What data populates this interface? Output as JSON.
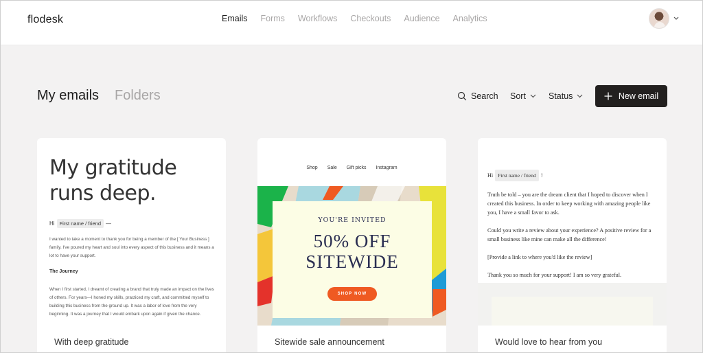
{
  "app": {
    "logo": "flodesk"
  },
  "nav": {
    "items": [
      "Emails",
      "Forms",
      "Workflows",
      "Checkouts",
      "Audience",
      "Analytics"
    ],
    "active": "Emails"
  },
  "header": {
    "tab_my_emails": "My emails",
    "tab_folders": "Folders",
    "search_label": "Search",
    "sort_label": "Sort",
    "status_label": "Status",
    "new_email_label": "New email"
  },
  "colors": {
    "primary_button": "#22201f",
    "accent_orange": "#ef5a22",
    "page_bg": "#f3f2f2"
  },
  "cards": [
    {
      "title": "With deep gratitude",
      "hero_line1": "My gratitude",
      "hero_line2": "runs deep.",
      "greeting": "Hi",
      "chip": "First name / friend",
      "greeting_suffix": "—",
      "para1": "I wanted to take a moment to thank you for being a member of the [ Your Business ] family. I've poured my heart and soul into every aspect of this business and it means a lot to have your support.",
      "heading": "The Journey",
      "para2": "When I first started, I dreamt of creating a brand that truly made an impact on the lives of others. For years—I honed my skills, practiced my craft, and committed myself to building this business from the ground up. It was a labor of love from the very beginning. It was a journey that I would embark upon again if given the chance."
    },
    {
      "title": "Sitewide sale announcement",
      "mini_nav": [
        "Shop",
        "Sale",
        "Gift picks",
        "Instagram"
      ],
      "invited": "YOU'RE INVITED",
      "line1": "50% OFF",
      "line2": "SITEWIDE",
      "shop_button": "SHOP NOW"
    },
    {
      "title": "Would love to hear from you",
      "greeting": "Hi",
      "chip": "First name / friend",
      "greeting_suffix": "!",
      "para1": "Truth be told – you are the dream client that I hoped to discover when I created this business. In order to keep working with amazing people like you, I have a small favor to ask.",
      "para2": "Could you write a review about your experience? A positive review for a small business like mine can make all the difference!",
      "para3": "[Provide a link to where you'd like the review]",
      "para4": "Thank you so much for your support! I am so very grateful."
    }
  ]
}
